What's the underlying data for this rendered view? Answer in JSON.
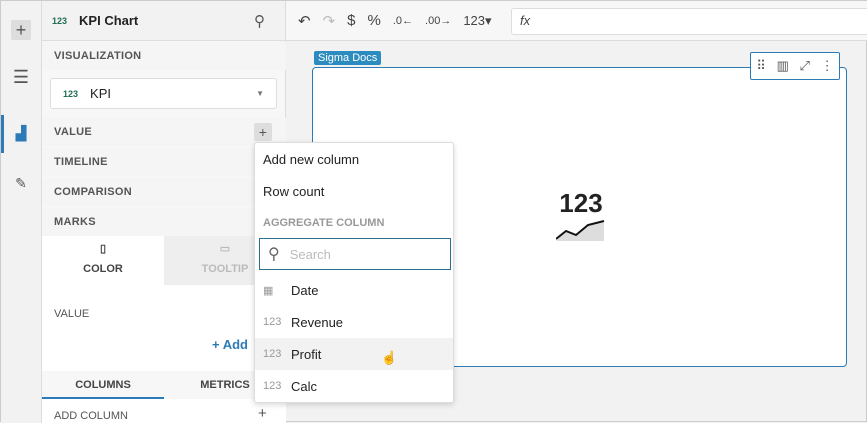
{
  "rail": {
    "items": [
      "add-icon",
      "outline-icon",
      "chart-icon",
      "paint-icon"
    ]
  },
  "panel": {
    "title": "KPI Chart",
    "kpi_glyph": "123",
    "visualization_label": "VISUALIZATION",
    "viz_selected": "KPI",
    "sections": [
      "VALUE",
      "TIMELINE",
      "COMPARISON",
      "MARKS"
    ],
    "marks_tabs": [
      "COLOR",
      "TOOLTIP"
    ],
    "value_label": "VALUE",
    "add_label": "+ Add",
    "bottom_tabs": [
      "COLUMNS",
      "METRICS"
    ],
    "add_column": "ADD COLUMN"
  },
  "toolbar": {
    "format_number": "123",
    "fx": "fx"
  },
  "canvas": {
    "tag": "Sigma Docs",
    "kpi_value": "123"
  },
  "menu": {
    "items": [
      "Add new column",
      "Row count"
    ],
    "section": "AGGREGATE COLUMN",
    "search_placeholder": "Search",
    "columns": [
      {
        "type": "date",
        "label": "Date"
      },
      {
        "type": "123",
        "label": "Revenue"
      },
      {
        "type": "123",
        "label": "Profit"
      },
      {
        "type": "123",
        "label": "Calc"
      }
    ],
    "hovered": "Profit"
  },
  "colors": {
    "accent": "#2c7bb6",
    "tag": "#2c8cc0",
    "kpi_green": "#1f6e55"
  }
}
